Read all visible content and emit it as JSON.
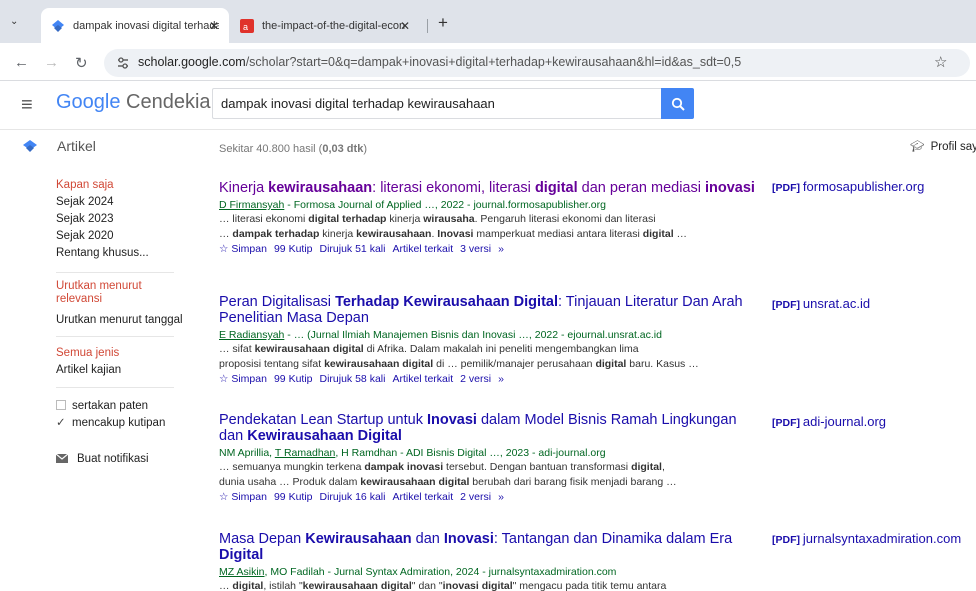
{
  "browser": {
    "tabs": [
      {
        "title": "dampak inovasi digital terhadap"
      },
      {
        "title": "the-impact-of-the-digital-econ"
      }
    ],
    "new_tab": "+",
    "url_host": "scholar.google.com",
    "url_path": "/scholar?start=0&q=dampak+inovasi+digital+terhadap+kewirausahaan&hl=id&as_sdt=0,5"
  },
  "header": {
    "logo_google": "Google",
    "logo_suffix": " Cendekia",
    "query": "dampak inovasi digital terhadap kewirausahaan"
  },
  "bar": {
    "section": "Artikel",
    "result_count": "Sekitar 40.800 hasil (0,03 dtk)",
    "profile": "Profil saya"
  },
  "sidebar": {
    "time": [
      "Kapan saja",
      "Sejak 2024",
      "Sejak 2023",
      "Sejak 2020",
      "Rentang khusus..."
    ],
    "sort": [
      "Urutkan menurut relevansi",
      "Urutkan menurut tanggal"
    ],
    "type": [
      "Semua jenis",
      "Artikel kajian"
    ],
    "include_patents": "sertakan paten",
    "include_citations": "mencakup kutipan",
    "alert": "Buat notifikasi"
  },
  "results": [
    {
      "title": [
        "Kinerja ",
        "kewirausahaan",
        ": literasi ekonomi, literasi ",
        "digital",
        " dan peran mediasi ",
        "inovasi"
      ],
      "author_link": "D Firmansyah",
      "meta": " - Formosa Journal of Applied …, 2022 - journal.formosapublisher.org",
      "snippet1": [
        "… literasi ekonomi ",
        "digital terhadap",
        " kinerja ",
        "wirausaha",
        ". Pengaruh literasi ekonomi dan literasi"
      ],
      "snippet2": [
        "… ",
        "dampak terhadap",
        " kinerja ",
        "kewirausahaan",
        ". ",
        "Inovasi",
        " mamperkuat mediasi antara literasi ",
        "digital",
        " …"
      ],
      "actions": {
        "save": "Simpan",
        "cite": "Kutip",
        "cited_by": "Dirujuk 51 kali",
        "related": "Artikel terkait",
        "versions": "3 versi"
      },
      "pdf_tag": "[PDF]",
      "pdf_source": "formosapublisher.org"
    },
    {
      "title": [
        "Peran Digitalisasi ",
        "Terhadap Kewirausahaan Digital",
        ": Tinjauan Literatur Dan Arah Penelitian Masa Depan"
      ],
      "author_link": "E Radiansyah",
      "meta": " - … (Jurnal Ilmiah Manajemen Bisnis dan Inovasi …, 2022 - ejournal.unsrat.ac.id",
      "snippet1": [
        "… sifat ",
        "kewirausahaan digital",
        " di Afrika. Dalam makalah ini peneliti mengembangkan lima"
      ],
      "snippet2": [
        "proposisi tentang sifat ",
        "kewirausahaan digital",
        " di … pemilik/manajer perusahaan ",
        "digital",
        " baru. Kasus …"
      ],
      "actions": {
        "save": "Simpan",
        "cite": "Kutip",
        "cited_by": "Dirujuk 58 kali",
        "related": "Artikel terkait",
        "versions": "2 versi"
      },
      "pdf_tag": "[PDF]",
      "pdf_source": "unsrat.ac.id"
    },
    {
      "title": [
        "Pendekatan Lean Startup untuk ",
        "Inovasi",
        " dalam Model Bisnis Ramah Lingkungan dan ",
        "Kewirausahaan Digital"
      ],
      "author_pre": "NM Aprillia, ",
      "author_link": "T Ramadhan",
      "meta": ", H Ramdhan - ADI Bisnis Digital …, 2023 - adi-journal.org",
      "snippet1": [
        "… semuanya mungkin terkena ",
        "dampak inovasi",
        " tersebut. Dengan bantuan transformasi ",
        "digital",
        ","
      ],
      "snippet2": [
        "dunia usaha … Produk dalam ",
        "kewirausahaan digital",
        " berubah dari barang fisik menjadi barang …"
      ],
      "actions": {
        "save": "Simpan",
        "cite": "Kutip",
        "cited_by": "Dirujuk 16 kali",
        "related": "Artikel terkait",
        "versions": "2 versi"
      },
      "pdf_tag": "[PDF]",
      "pdf_source": "adi-journal.org"
    },
    {
      "title": [
        "Masa Depan ",
        "Kewirausahaan",
        " dan ",
        "Inovasi",
        ": Tantangan dan Dinamika dalam Era ",
        "Digital"
      ],
      "author_link": "MZ Asikin",
      "meta": ", MO Fadilah - Jurnal Syntax Admiration, 2024 - jurnalsyntaxadmiration.com",
      "snippet1": [
        "… ",
        "digital",
        ", istilah \"",
        "kewirausahaan digital",
        "\" dan \"",
        "inovasi digital",
        "\" mengacu pada titik temu antara"
      ],
      "pdf_tag": "[PDF]",
      "pdf_source": "jurnalsyntaxadmiration.com"
    }
  ],
  "colors": {
    "link": "#1a0dab",
    "visited": "#660099",
    "green": "#006621",
    "red": "#d14836",
    "brand_blue": "#4285f4"
  }
}
